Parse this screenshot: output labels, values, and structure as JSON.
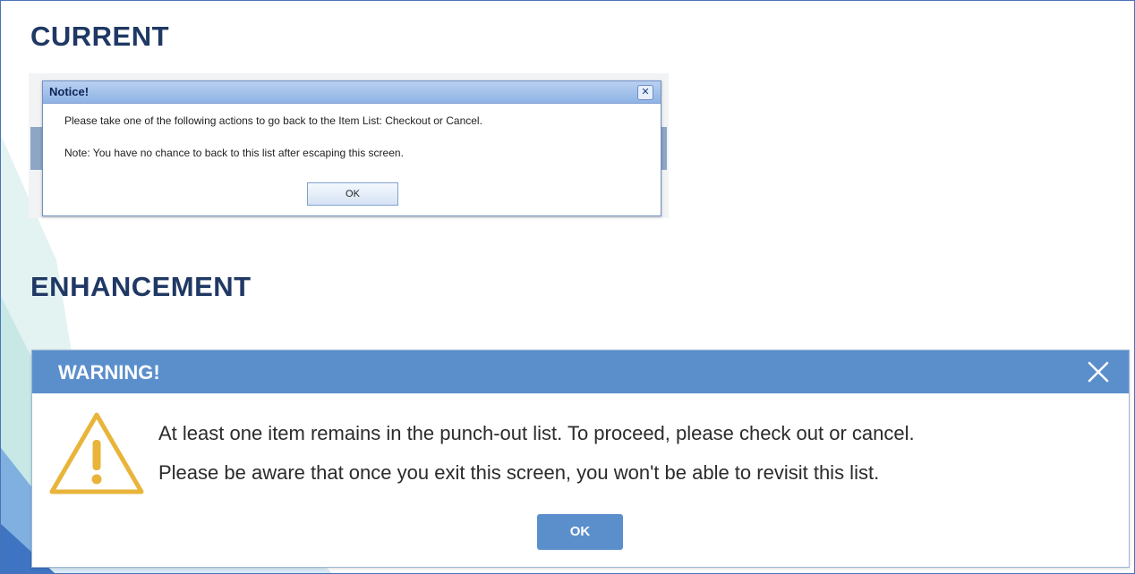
{
  "current": {
    "heading": "CURRENT",
    "dialog": {
      "title": "Notice!",
      "close_glyph": "✕",
      "line1": "Please take one of the following actions to go back to the Item List: Checkout or Cancel.",
      "line2": "Note: You have no chance to back to this list after escaping this screen.",
      "ok_label": "OK"
    }
  },
  "enhancement": {
    "heading": "ENHANCEMENT",
    "dialog": {
      "title": "WARNING!",
      "icon": "warning-triangle-icon",
      "line1": "At least one item remains in the punch-out list. To proceed, please check out or cancel.",
      "line2": "Please be aware that once you exit this screen, you won't be able to revisit this list.",
      "ok_label": "OK"
    }
  },
  "colors": {
    "heading": "#1f3864",
    "new_titlebar": "#5b8fcc",
    "warning_icon": "#e8b43a",
    "old_titlebar": "#8fb3e5",
    "frame_border": "#4a72b8"
  }
}
